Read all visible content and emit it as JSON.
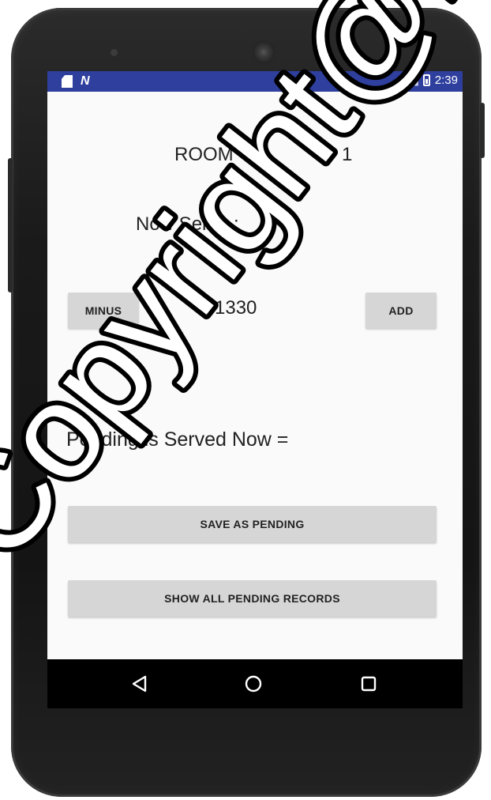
{
  "status_bar": {
    "time": "2:39",
    "icons": [
      "sd-card-icon",
      "n-notification-icon",
      "signal-icon",
      "battery-icon"
    ]
  },
  "room": {
    "label": "ROOM",
    "value": "1"
  },
  "now_serve": {
    "label": "Now Serve :",
    "value": "1330"
  },
  "buttons": {
    "minus": "MINUS",
    "add": "ADD",
    "save_pending": "SAVE AS PENDING",
    "show_pending": "SHOW ALL PENDING RECORDS"
  },
  "pending": {
    "label": "Pending is Served Now ="
  },
  "nav": {
    "icons": [
      "back-triangle-icon",
      "home-circle-icon",
      "recents-square-icon"
    ]
  },
  "watermark": {
    "text": "Copyright@F"
  },
  "colors": {
    "status_bar": "#2e3f9e",
    "screen_bg": "#fafafa",
    "button_bg": "#d6d6d6",
    "phone_body": "#1a1a1a"
  }
}
